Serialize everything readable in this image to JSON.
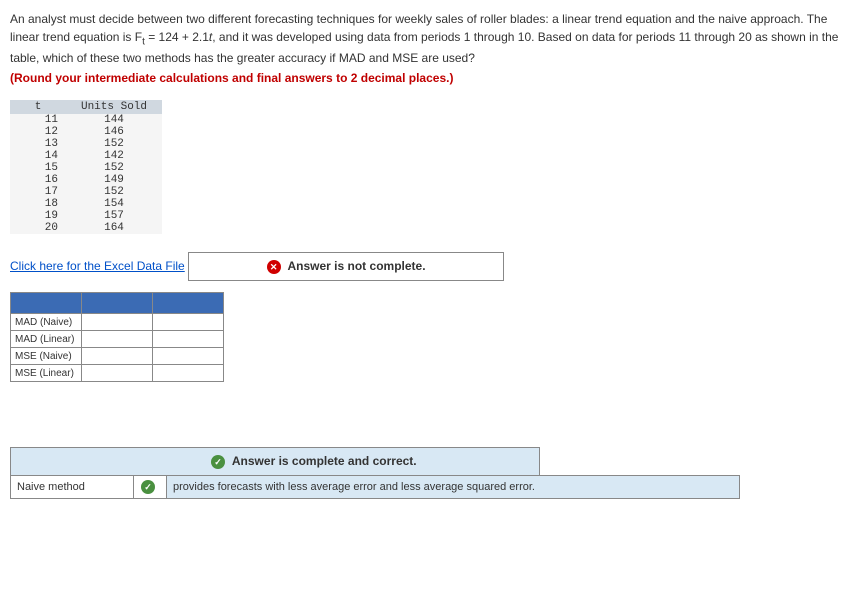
{
  "question": {
    "p1": "An analyst must decide between two different forecasting techniques for weekly sales of roller blades: a linear trend equation and the naive approach. The linear trend equation is F",
    "sub1": "t",
    "p2": " = 124 + 2.1",
    "it1": "t",
    "p3": ", and it was developed using data from periods 1 through 10. Based on data for periods 11 through 20 as shown in the table, which of these two methods has the greater accuracy if MAD and MSE are used?",
    "instruction": "(Round your intermediate calculations and final answers to 2 decimal places.)"
  },
  "data_table": {
    "headers": {
      "t": "t",
      "units": "Units Sold"
    },
    "rows": [
      {
        "t": "11",
        "u": "144"
      },
      {
        "t": "12",
        "u": "146"
      },
      {
        "t": "13",
        "u": "152"
      },
      {
        "t": "14",
        "u": "142"
      },
      {
        "t": "15",
        "u": "152"
      },
      {
        "t": "16",
        "u": "149"
      },
      {
        "t": "17",
        "u": "152"
      },
      {
        "t": "18",
        "u": "154"
      },
      {
        "t": "19",
        "u": "157"
      },
      {
        "t": "20",
        "u": "164"
      }
    ]
  },
  "excel_link": "Click here for the Excel Data File",
  "status": {
    "incomplete": "Answer is not complete.",
    "complete": "Answer is complete and correct."
  },
  "answer_labels": {
    "mad_naive": "MAD (Naive)",
    "mad_linear": "MAD (Linear)",
    "mse_naive": "MSE (Naive)",
    "mse_linear": "MSE (Linear)"
  },
  "result": {
    "label": "Naive method",
    "text": "provides forecasts with less average error and less average squared error."
  }
}
